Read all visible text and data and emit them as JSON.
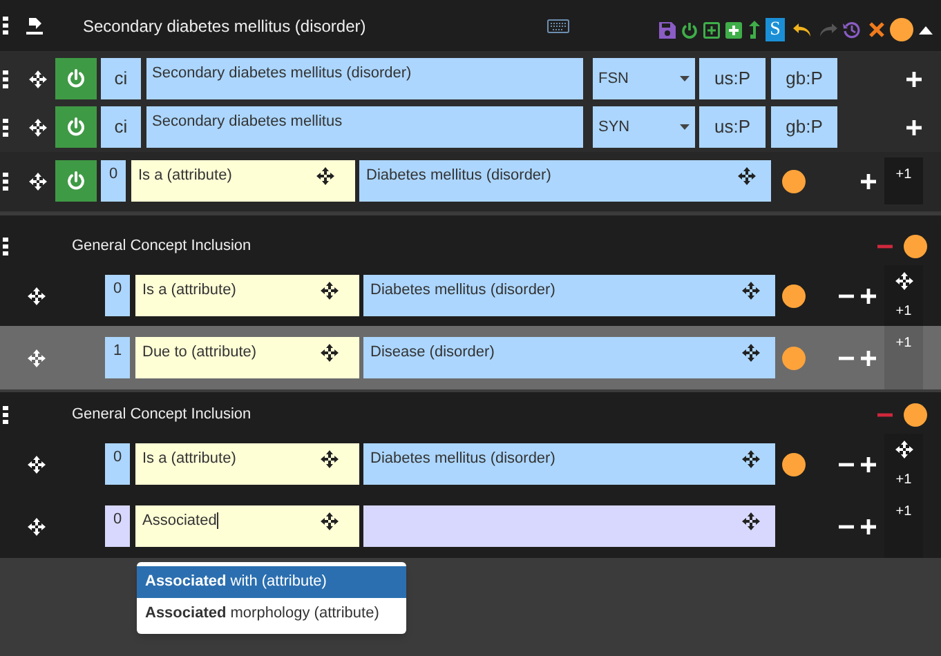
{
  "header": {
    "title": "Secondary diabetes mellitus (disorder)",
    "toolbar_badge": "S"
  },
  "descriptions": [
    {
      "active": true,
      "case": "ci",
      "term": "Secondary diabetes mellitus (disorder)",
      "type": "FSN",
      "acceptability": [
        "us:P",
        "gb:P"
      ]
    },
    {
      "active": true,
      "case": "ci",
      "term": "Secondary diabetes mellitus",
      "type": "SYN",
      "acceptability": [
        "us:P",
        "gb:P"
      ]
    }
  ],
  "relationships": [
    {
      "active": true,
      "group": "0",
      "type": "Is a (attribute)",
      "target": "Diabetes mellitus (disorder)",
      "side_label": "+1"
    }
  ],
  "gci_groups": [
    {
      "title": "General Concept Inclusion",
      "rows": [
        {
          "selected": false,
          "group": "0",
          "type": "Is a (attribute)",
          "target": "Diabetes mellitus (disorder)",
          "side_move": true,
          "side_label": "+1"
        },
        {
          "selected": true,
          "group": "1",
          "type": "Due to (attribute)",
          "target": "Disease (disorder)",
          "side_move": false,
          "side_label": "+1"
        }
      ]
    },
    {
      "title": "General Concept Inclusion",
      "rows": [
        {
          "selected": false,
          "group": "0",
          "type": "Is a (attribute)",
          "target": "Diabetes mellitus (disorder)",
          "side_move": true,
          "side_label": "+1"
        },
        {
          "selected": false,
          "kind": "draft",
          "group": "0",
          "type_input": "Associated",
          "side_move": false,
          "side_label": "+1"
        }
      ]
    }
  ],
  "suggestions": [
    {
      "label": "**Associated** with (attribute)",
      "selected": true
    },
    {
      "label": "**Associated** morphology (attribute)",
      "selected": false
    }
  ]
}
